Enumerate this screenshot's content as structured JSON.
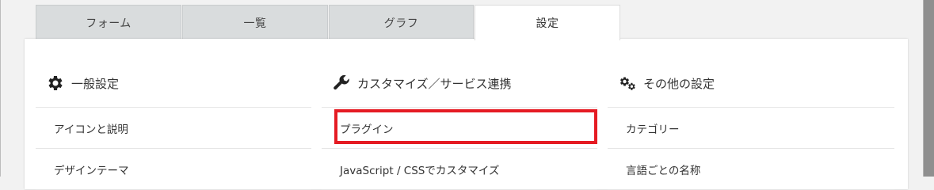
{
  "tabs": [
    {
      "label": "フォーム"
    },
    {
      "label": "一覧"
    },
    {
      "label": "グラフ"
    },
    {
      "label": "設定"
    }
  ],
  "columns": [
    {
      "icon": "gear-icon",
      "title": "一般設定",
      "items": [
        "アイコンと説明",
        "デザインテーマ"
      ]
    },
    {
      "icon": "wrench-icon",
      "title": "カスタマイズ／サービス連携",
      "items": [
        "プラグイン",
        "JavaScript / CSSでカスタマイズ"
      ]
    },
    {
      "icon": "gears-icon",
      "title": "その他の設定",
      "items": [
        "カテゴリー",
        "言語ごとの名称"
      ]
    }
  ],
  "highlight_color": "#e51b23"
}
